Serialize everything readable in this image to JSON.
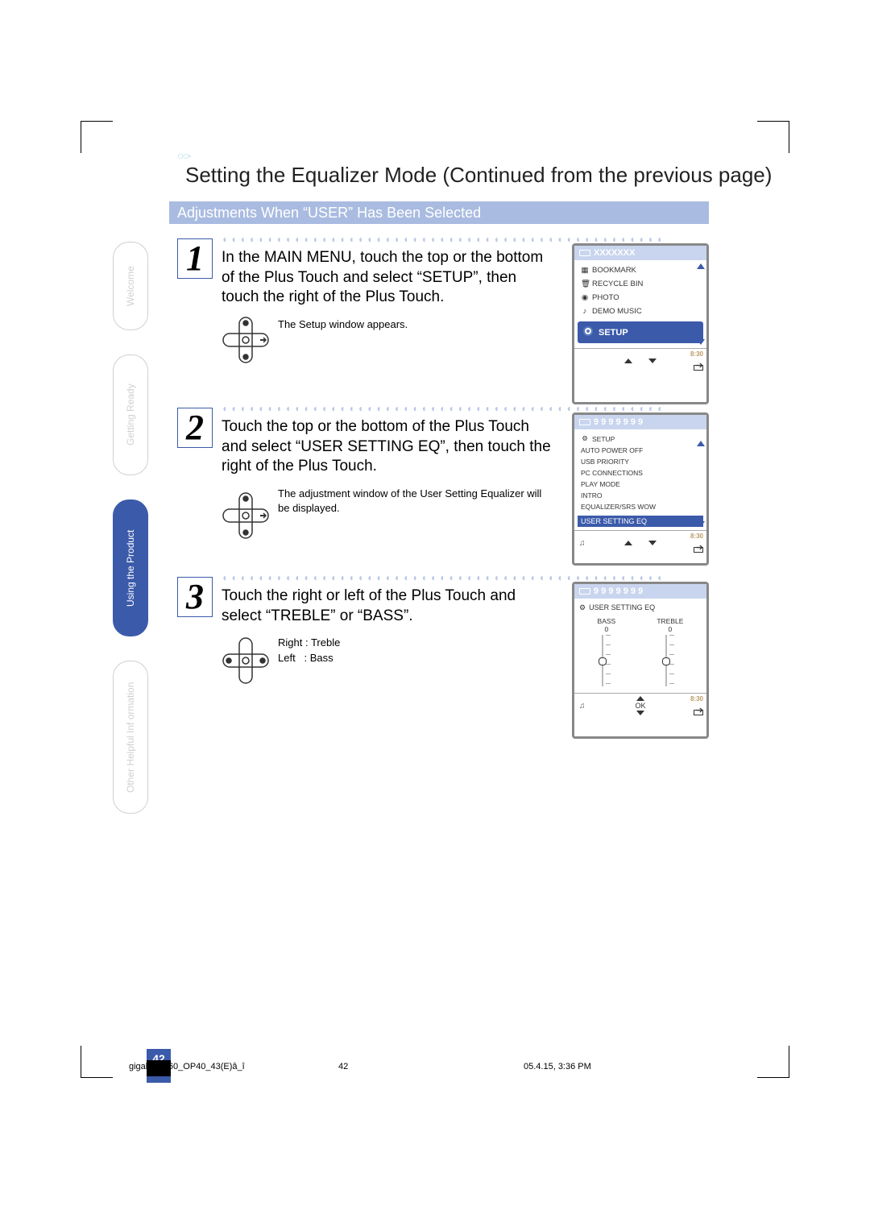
{
  "page_title": "Setting the Equalizer Mode (Continued from the previous page)",
  "section_bar": "Adjustments When “USER” Has Been Selected",
  "side_tabs": [
    {
      "label": "Welcome",
      "active": false
    },
    {
      "label": "Getting Ready",
      "active": false
    },
    {
      "label": "Using the Product",
      "active": true
    },
    {
      "label": "Other Helpful Inf ormation",
      "active": false
    }
  ],
  "steps": [
    {
      "num": "1",
      "title": "In the MAIN MENU, touch the top or the bottom of the Plus Touch and select “SETUP”, then touch the right of the Plus Touch.",
      "sub": "The Setup window appears."
    },
    {
      "num": "2",
      "title": "Touch the top or the bottom of the Plus Touch and select “USER SETTING EQ”, then touch the right of the Plus Touch.",
      "sub": "The adjustment window of the User Setting Equalizer will be displayed."
    },
    {
      "num": "3",
      "title": "Touch the right or left of the Plus Touch and select “TREBLE” or “BASS”.",
      "sub": "Right : Treble\nLeft   : Bass"
    }
  ],
  "device1": {
    "header": "XXXXXXX",
    "items": [
      "BOOKMARK",
      "RECYCLE BIN",
      "PHOTO",
      "DEMO MUSIC"
    ],
    "selected": "SETUP",
    "foot_time": "8:30"
  },
  "device2": {
    "header": "9 9 9 9 9 9 9",
    "subheader": "SETUP",
    "items": [
      "AUTO POWER OFF",
      "USB PRIORITY",
      "PC CONNECTIONS",
      "PLAY MODE",
      "INTRO",
      "EQUALIZER/SRS WOW"
    ],
    "selected": "USER SETTING EQ",
    "foot_time": "8:30"
  },
  "device3": {
    "header": "9 9 9 9 9 9 9",
    "subheader": "USER SETTING EQ",
    "bass_label": "BASS",
    "bass_value": "0",
    "treble_label": "TREBLE",
    "treble_value": "0",
    "ok": "OK",
    "foot_time": "8:30"
  },
  "page_number": "42",
  "footer": {
    "file": "gigabeatF60_OP40_43(E)â_î",
    "page": "42",
    "timestamp": "05.4.15, 3:36 PM"
  }
}
